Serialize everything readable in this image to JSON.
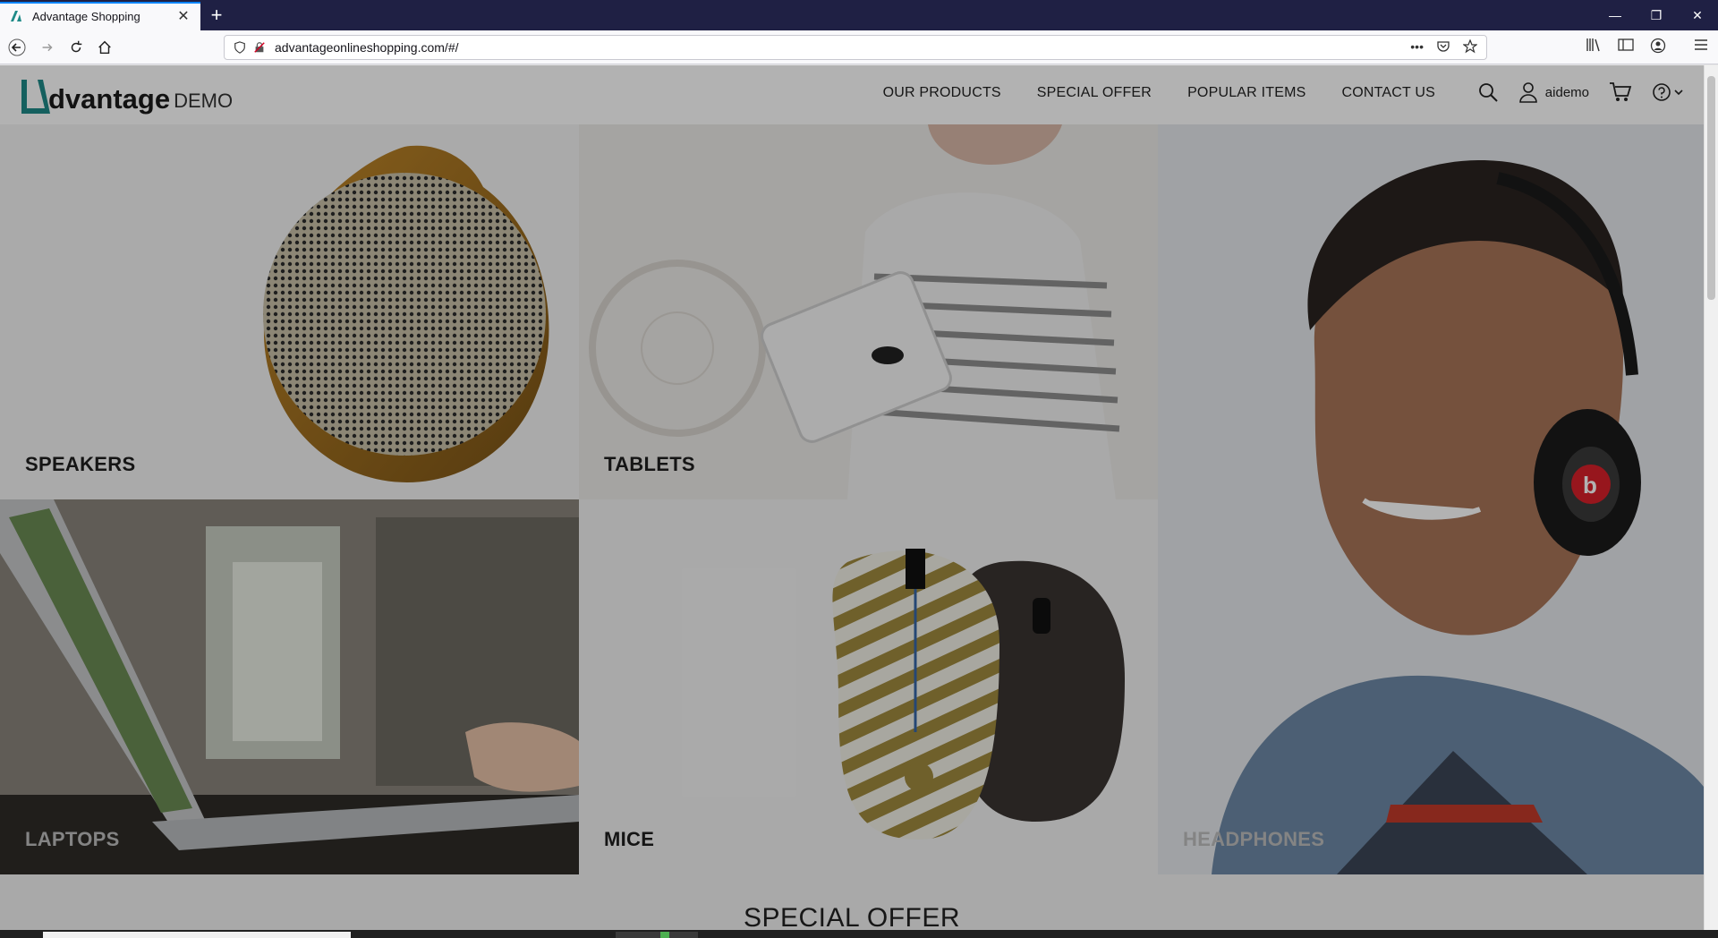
{
  "browser": {
    "tab_title": "Advantage Shopping",
    "close_tab_glyph": "✕",
    "new_tab_glyph": "+",
    "url": "advantageonlineshopping.com/#/",
    "window_controls": [
      "—",
      "❐",
      "✕"
    ],
    "url_more_glyph": "•••"
  },
  "site": {
    "logo_text": "dvantage",
    "logo_demo": "DEMO",
    "nav": [
      "OUR PRODUCTS",
      "SPECIAL OFFER",
      "POPULAR ITEMS",
      "CONTACT US"
    ],
    "username": "aidemo"
  },
  "categories": {
    "speakers": "SPEAKERS",
    "tablets": "TABLETS",
    "headphones": "HEADPHONES",
    "laptops": "LAPTOPS",
    "mice": "MICE"
  },
  "special_offer_heading": "SPECIAL OFFER",
  "colors": {
    "brand_teal": "#1f8a88",
    "titlebar": "#1f2044",
    "overlay": "rgba(0,0,0,0.30)"
  },
  "icons": {
    "back": "back-arrow-icon",
    "forward": "forward-arrow-icon",
    "reload": "reload-icon",
    "home": "home-icon",
    "search": "search-icon",
    "user": "user-icon",
    "cart": "cart-icon",
    "help": "help-icon"
  }
}
